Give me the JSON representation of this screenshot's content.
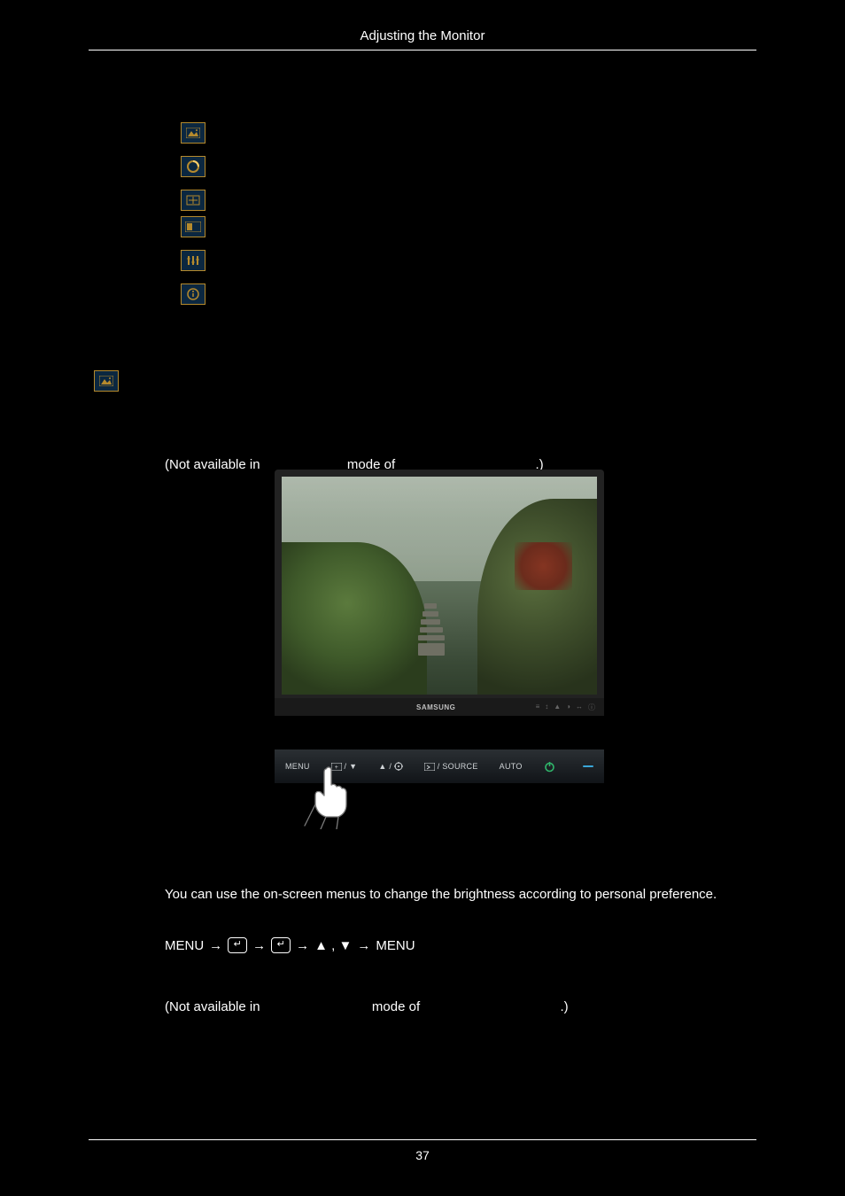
{
  "header": {
    "title": "Adjusting the Monitor"
  },
  "leftBadge": {
    "name": "picture-mode-icon"
  },
  "iconStack": [
    {
      "name": "picture-mode-icon"
    },
    {
      "name": "color-ring-icon"
    },
    {
      "name": "screen-size-icon"
    },
    {
      "name": "aspect-icon"
    },
    {
      "name": "equalizer-icon"
    },
    {
      "name": "info-icon"
    }
  ],
  "line1": {
    "pre": "(Not available in ",
    "mid": " mode of ",
    "post": ".)"
  },
  "photo": {
    "brand": "SAMSUNG",
    "chinIcons": [
      "≡",
      "↕",
      "▲",
      "◑",
      "↔",
      "ⓘ"
    ]
  },
  "strip": {
    "menu": "MENU",
    "item2": " / ▼",
    "item3": "▲ / ",
    "source": " / SOURCE",
    "auto": "AUTO"
  },
  "paragraph": "You can use the on-screen menus to change the brightness according to personal preference.",
  "sequence": {
    "start": "MENU",
    "arrow": "→",
    "updown": "▲ , ▼",
    "end": "MENU"
  },
  "line2": {
    "pre": "(Not available in ",
    "mid": " mode of ",
    "post": ".)"
  },
  "footer": {
    "page": "37"
  }
}
